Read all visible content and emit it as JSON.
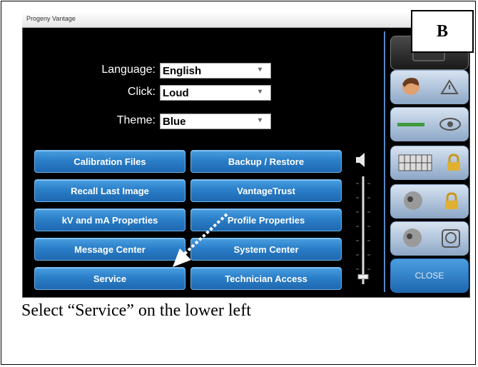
{
  "window": {
    "title": "Progeny Vantage"
  },
  "panel_tag": "B",
  "settings": [
    {
      "label": "Language:",
      "value": "English"
    },
    {
      "label": "Click:",
      "value": "Loud"
    },
    {
      "label": "Theme:",
      "value": "Blue"
    }
  ],
  "buttons": {
    "calibration": "Calibration Files",
    "backup": "Backup / Restore",
    "recall": "Recall Last Image",
    "vantagetrust": "VantageTrust",
    "kvma": "kV and mA Properties",
    "profile": "Profile Properties",
    "message": "Message Center",
    "system": "System Center",
    "service": "Service",
    "technician": "Technician Access"
  },
  "sidebar": {
    "close_label": "CLOSE"
  },
  "volume": {
    "level": 0.05
  },
  "caption": "Select “Service” on the lower left",
  "colors": {
    "button_blue": "#2b7fc9",
    "screen_bg": "#000000",
    "arrow": "#ffffff"
  }
}
